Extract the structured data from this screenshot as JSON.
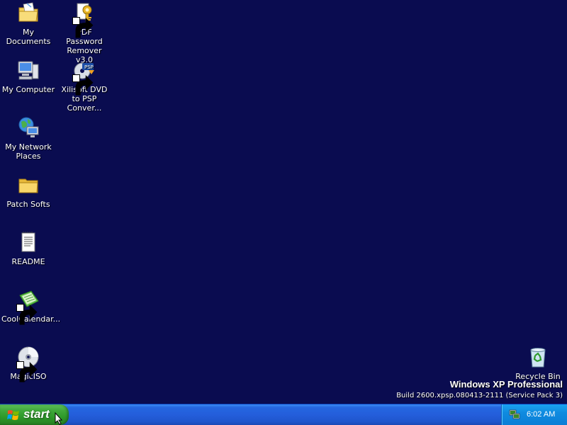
{
  "desktop": {
    "icons": [
      {
        "label": "My Documents",
        "icon": "my-documents-icon"
      },
      {
        "label": "PDF Password Remover v3.0",
        "icon": "pdf-password-remover-icon",
        "shortcut": true
      },
      {
        "label": "My Computer",
        "icon": "my-computer-icon"
      },
      {
        "label": "Xilisoft DVD to PSP Conver...",
        "icon": "xilisoft-dvd-psp-icon",
        "shortcut": true
      },
      {
        "label": "My Network Places",
        "icon": "network-places-icon"
      },
      {
        "label": "Patch Softs",
        "icon": "folder-icon"
      },
      {
        "label": "README",
        "icon": "text-document-icon"
      },
      {
        "label": "CoolCalendar...",
        "icon": "cool-calendar-icon",
        "shortcut": true
      },
      {
        "label": "MagicISO",
        "icon": "magiciso-disc-icon",
        "shortcut": true
      },
      {
        "label": "Recycle Bin",
        "icon": "recycle-bin-icon"
      }
    ],
    "background_color": "#0a0c50"
  },
  "watermark": {
    "title": "Windows XP Professional",
    "build": "Build 2600.xpsp.080413-2111 (Service Pack 3)"
  },
  "taskbar": {
    "start_label": "start",
    "clock": "6:02 AM",
    "tray_icon": "network-tray-icon",
    "colors": {
      "taskbar": "#245edb",
      "start": "#3fa83a",
      "tray": "#0f8be0"
    }
  }
}
